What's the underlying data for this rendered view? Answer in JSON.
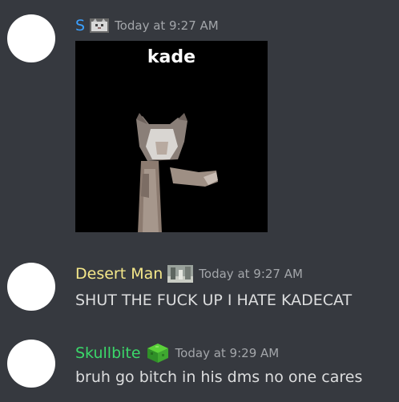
{
  "colors": {
    "background": "#36393f",
    "username_s": "#3ba0ff",
    "username_desert_man": "#f5e88a",
    "username_skullbite": "#3bd86a",
    "timestamp": "#a3a6aa",
    "message_text": "#dcddde"
  },
  "messages": [
    {
      "username": "S",
      "role_icon": "cat-icon",
      "timestamp": "Today at 9:27 AM",
      "attachment": {
        "type": "gif",
        "caption": "kade",
        "subject": "dancing-cat"
      }
    },
    {
      "username": "Desert Man",
      "role_icon": "landscape-icon",
      "timestamp": "Today at 9:27 AM",
      "text": "SHUT THE FUCK UP I HATE KADECAT"
    },
    {
      "username": "Skullbite",
      "role_icon": "green-cube-icon",
      "timestamp": "Today at 9:29 AM",
      "text": "bruh go bitch in his dms no one cares"
    }
  ]
}
